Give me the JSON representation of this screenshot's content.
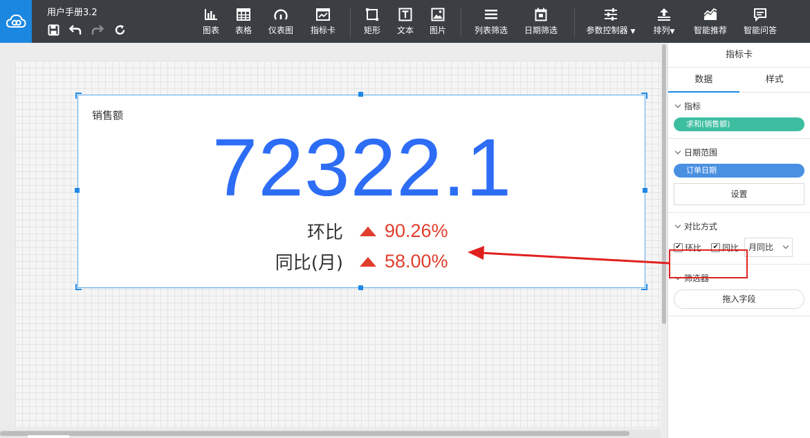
{
  "app": {
    "doc_title": "用户手册3.2"
  },
  "toolbar": {
    "tools": [
      {
        "key": "chart",
        "label": "图表"
      },
      {
        "key": "table",
        "label": "表格"
      },
      {
        "key": "gauge",
        "label": "仪表图"
      },
      {
        "key": "kpi",
        "label": "指标卡"
      },
      {
        "key": "rect",
        "label": "矩形"
      },
      {
        "key": "text",
        "label": "文本"
      },
      {
        "key": "image",
        "label": "图片"
      },
      {
        "key": "listfilter",
        "label": "列表筛选"
      },
      {
        "key": "datefilter",
        "label": "日期筛选"
      },
      {
        "key": "param",
        "label": "参数控制器"
      },
      {
        "key": "arrange",
        "label": "排列"
      },
      {
        "key": "recommend",
        "label": "智能推荐"
      },
      {
        "key": "qa",
        "label": "智能问答"
      }
    ]
  },
  "kpi": {
    "title": "销售额",
    "value": "72322.1",
    "mom_label": "环比",
    "mom_value": "90.26%",
    "yoy_label": "同比(月)",
    "yoy_value": "58.00%"
  },
  "panel": {
    "title": "指标卡",
    "tab_data": "数据",
    "tab_style": "样式",
    "sec_metric": "指标",
    "metric_pill": "求和(销售额)",
    "sec_date": "日期范围",
    "date_pill": "订单日期",
    "set_button": "设置",
    "sec_compare": "对比方式",
    "cb_mom": "环比",
    "cb_yoy": "同比",
    "yoy_select": "月同比",
    "sec_filter": "筛选器",
    "drag_field": "拖入字段"
  },
  "colors": {
    "accent": "#1b87e0",
    "value_blue": "#2d6df6",
    "up_red": "#e03e2d",
    "pill_green": "#3dbea0",
    "pill_blue": "#4a90e2",
    "annotation_red": "#e0201e"
  }
}
